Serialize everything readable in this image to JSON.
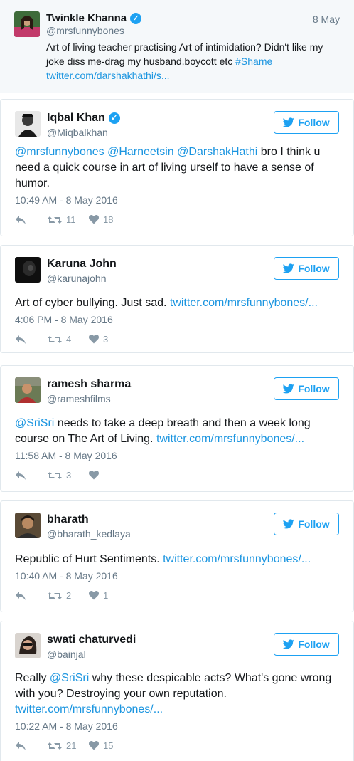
{
  "quote": {
    "name": "Twinkle Khanna",
    "handle": "@mrsfunnybones",
    "date": "8 May",
    "text_line1": "Art of living teacher practising Art of intimidation? Didn't like my",
    "text_line2_pre": "joke diss me-drag my husband,boycott etc ",
    "text_hashtag": "#Shame",
    "text_link": "twitter.com/darshakhathi/s..."
  },
  "follow_label": "Follow",
  "tweets": [
    {
      "name": "Iqbal Khan",
      "handle": "@Miqbalkhan",
      "mentions": "@mrsfunnybones @Harneetsin @DarshakHathi",
      "text_rest": " bro I think u need a quick course in art of living urself to have a sense of humor.",
      "time": "10:49 AM - 8 May 2016",
      "retweets": "11",
      "likes": "18"
    },
    {
      "name": "Karuna John",
      "handle": "@karunajohn",
      "text": "Art of cyber bullying. Just sad. ",
      "link": "twitter.com/mrsfunnybones/...",
      "time": "4:06 PM - 8 May 2016",
      "retweets": "4",
      "likes": "3"
    },
    {
      "name": "ramesh sharma",
      "handle": "@rameshfilms",
      "mention": "@SriSri",
      "text_rest": " needs to take a deep breath and then a week long course on The Art of Living. ",
      "link": "twitter.com/mrsfunnybones/...",
      "time": "11:58 AM - 8 May 2016",
      "retweets": "3",
      "likes": ""
    },
    {
      "name": "bharath",
      "handle": "@bharath_kedlaya",
      "text": "Republic of Hurt Sentiments. ",
      "link": "twitter.com/mrsfunnybones/...",
      "time": "10:40 AM - 8 May 2016",
      "retweets": "2",
      "likes": "1"
    },
    {
      "name": "swati chaturvedi",
      "handle": "@bainjal",
      "text_pre": "Really ",
      "mention": "@SriSri",
      "text_rest": " why these despicable acts? What's gone wrong with you? Destroying your own reputation. ",
      "link": "twitter.com/mrsfunnybones/...",
      "time": "10:22 AM - 8 May 2016",
      "retweets": "21",
      "likes": "15"
    }
  ],
  "colors": {
    "link": "#1b95e0",
    "accent": "#1da1f2",
    "muted": "#657786"
  }
}
